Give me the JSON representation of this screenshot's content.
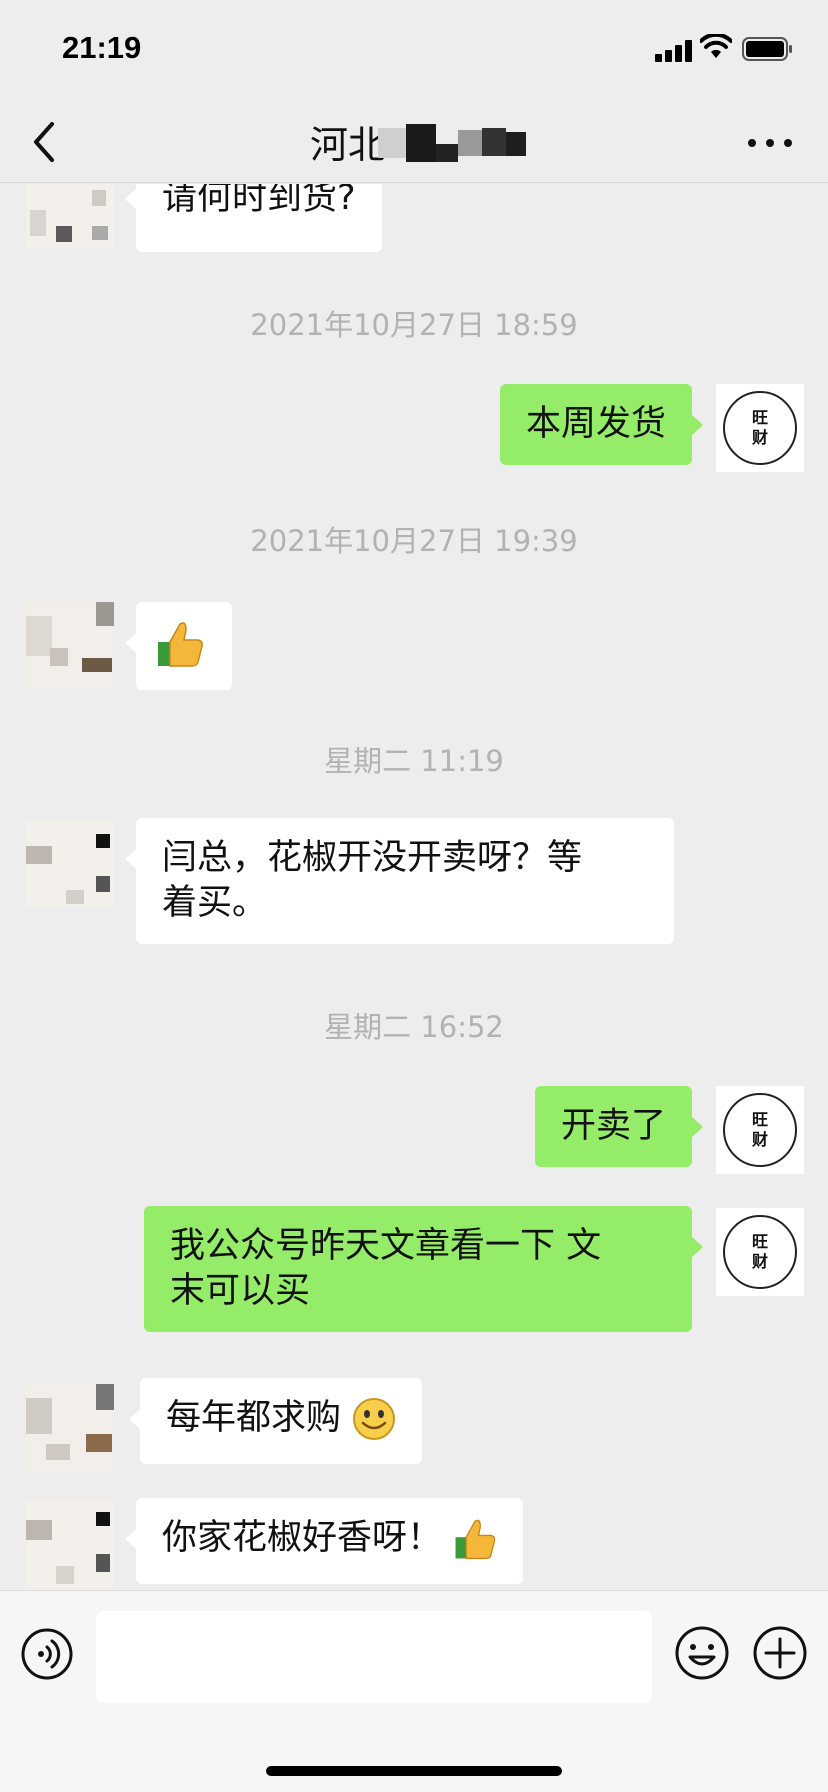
{
  "status_bar": {
    "time": "21:19"
  },
  "header": {
    "title_visible": "河北"
  },
  "messages": [
    {
      "side": "in",
      "text": "请何时到货?"
    },
    {
      "timestamp": "2021年10月27日 18:59"
    },
    {
      "side": "out",
      "text": "本周发货"
    },
    {
      "timestamp": "2021年10月27日 19:39"
    },
    {
      "side": "in",
      "emoji": "thumbs-up"
    },
    {
      "timestamp": "星期二 11:19"
    },
    {
      "side": "in",
      "text_line1": "闫总，花椒开没开卖呀？等",
      "text_line2": "着买。"
    },
    {
      "timestamp": "星期二 16:52"
    },
    {
      "side": "out",
      "text": "开卖了"
    },
    {
      "side": "out",
      "text_line1": "我公众号昨天文章看一下 文",
      "text_line2": "末可以买"
    },
    {
      "side": "in",
      "text": "每年都求购",
      "emoji": "smile"
    },
    {
      "side": "in",
      "text": "你家花椒好香呀！",
      "emoji": "thumbs-up"
    }
  ],
  "self_avatar": {
    "line1": "旺",
    "line2": "财"
  },
  "icons": {
    "back": "chevron-left-icon",
    "more": "more-icon",
    "voice": "voice-icon",
    "emoji": "emoji-icon",
    "plus": "plus-icon"
  },
  "colors": {
    "background": "#ededed",
    "outgoing_bubble": "#95ec69",
    "incoming_bubble": "#ffffff",
    "timestamp_text": "#b2b2b2"
  }
}
